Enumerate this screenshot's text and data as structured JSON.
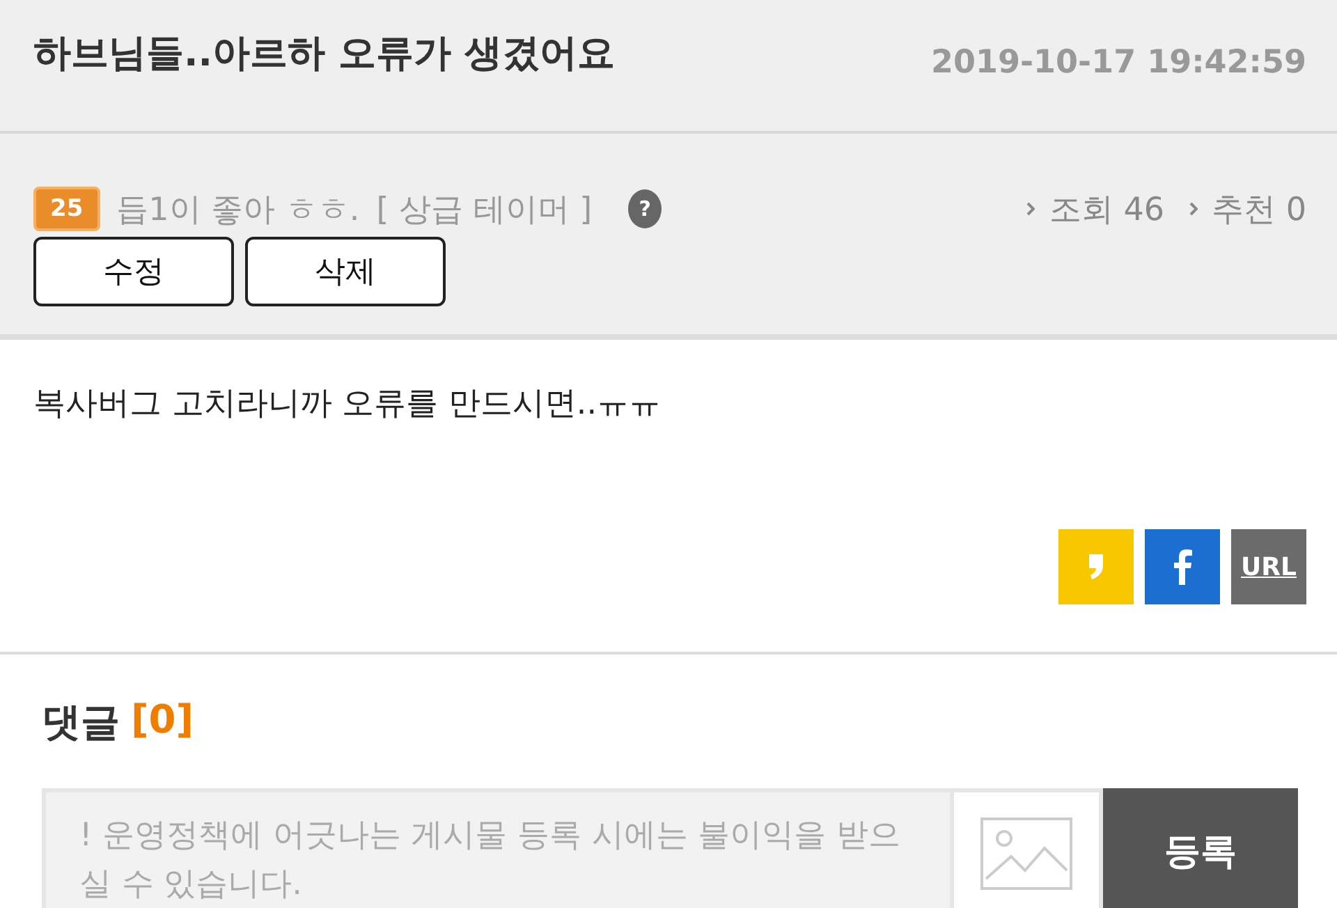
{
  "post": {
    "title": "하브님들..아르하 오류가 생겼어요",
    "date": "2019-10-17 19:42:59"
  },
  "author": {
    "level": "25",
    "name": "듭1이 좋아 ㅎㅎ.",
    "rank": "[ 상급 테이머 ]",
    "help_icon": "?"
  },
  "stats": [
    {
      "label": "조회 46"
    },
    {
      "label": "추천 0"
    }
  ],
  "actions": [
    "수정",
    "삭제"
  ],
  "body": "복사버그 고치라니까 오류를 만드시면..ㅠㅠ",
  "share": [
    {
      "kind": "kakao",
      "color": "#f9c700"
    },
    {
      "kind": "facebook",
      "color": "#1b6fd0"
    },
    {
      "kind": "url",
      "color": "#6b6b6b",
      "label": "URL"
    }
  ],
  "comments": {
    "title": "댓글",
    "count": "[0]",
    "placeholder": "! 운영정책에 어긋나는 게시물 등록 시에는 불이익을 받으실 수 있습니다.",
    "submit": "등록"
  }
}
